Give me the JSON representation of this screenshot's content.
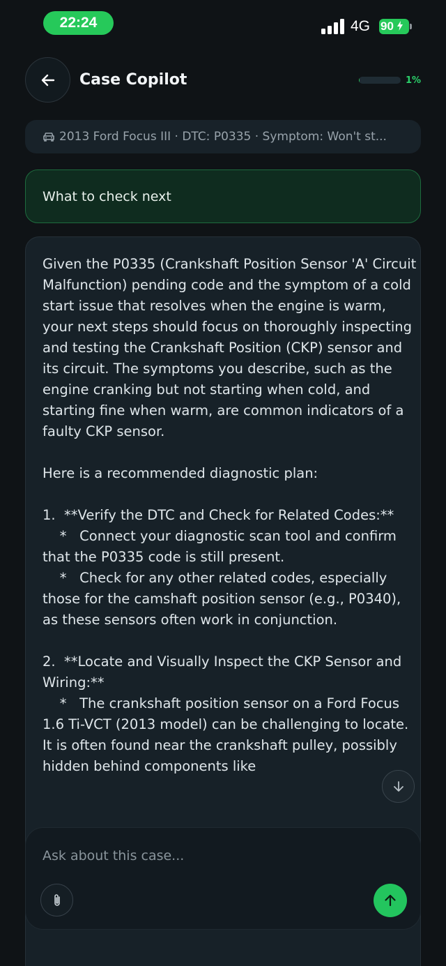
{
  "status_bar": {
    "time": "22:24",
    "network": "4G",
    "battery": "90"
  },
  "header": {
    "title": "Case Copilot",
    "progress_percent": 1,
    "progress_label": "1%"
  },
  "context": {
    "icon": "car-icon",
    "text": "2013 Ford Focus III · DTC: P0335 · Symptom: Won't st..."
  },
  "messages": {
    "user": "What to check next",
    "assistant": "Given the P0335 (Crankshaft Position Sensor 'A' Circuit Malfunction) pending code and the symptom of a cold start issue that resolves when the engine is warm, your next steps should focus on thoroughly inspecting and testing the Crankshaft Position (CKP) sensor and its circuit. The symptoms you describe, such as the engine cranking but not starting when cold, and starting fine when warm, are common indicators of a faulty CKP sensor.\n\nHere is a recommended diagnostic plan:\n\n1.  **Verify the DTC and Check for Related Codes:**\n    *   Connect your diagnostic scan tool and confirm that the P0335 code is still present.\n    *   Check for any other related codes, especially those for the camshaft position sensor (e.g., P0340), as these sensors often work in conjunction.\n\n2.  **Locate and Visually Inspect the CKP Sensor and Wiring:**\n    *   The crankshaft position sensor on a Ford Focus 1.6 Ti-VCT (2013 model) can be challenging to locate. It is often found near the crankshaft pulley, possibly hidden behind components like"
  },
  "composer": {
    "placeholder": "Ask about this case..."
  },
  "colors": {
    "accent": "#23c55e",
    "background": "#0f1316"
  }
}
